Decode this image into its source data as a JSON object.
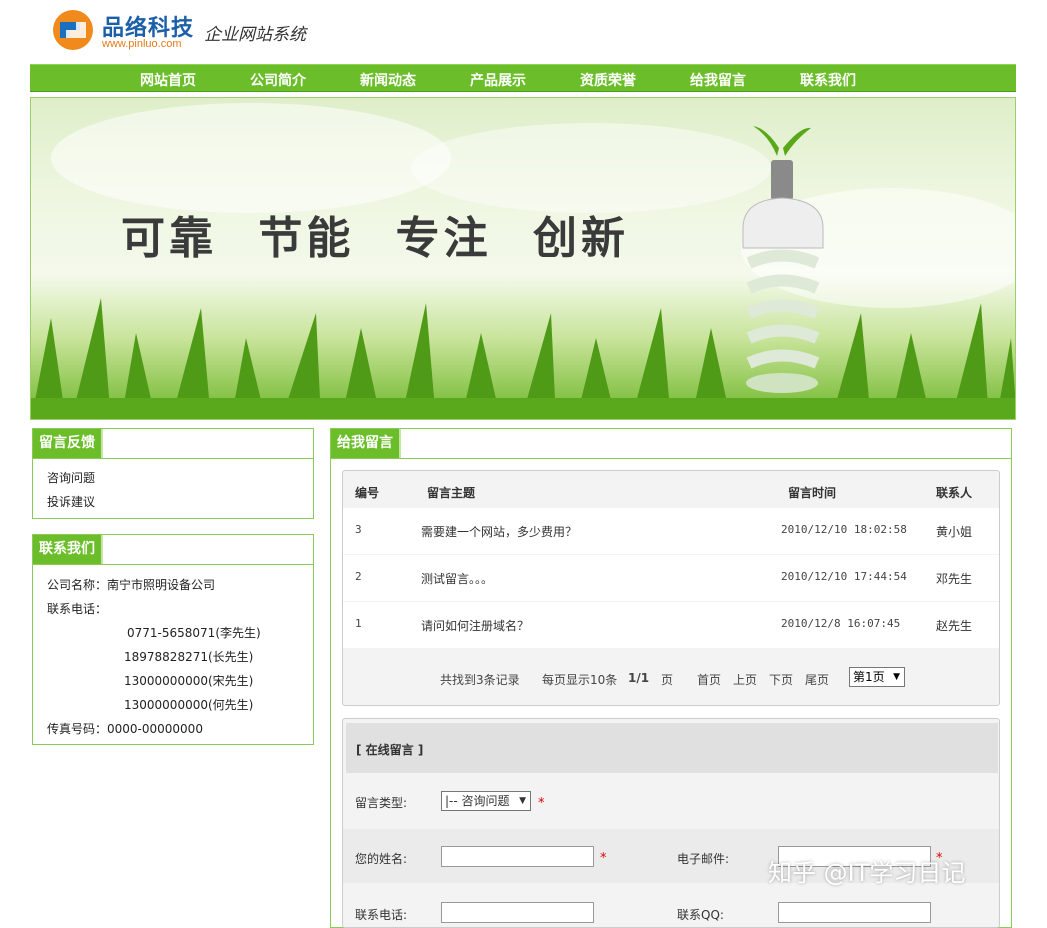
{
  "brand": {
    "name": "品络科技",
    "url": "www.pinluo.com",
    "subtitle": "企业网站系统"
  },
  "nav": [
    "网站首页",
    "公司简介",
    "新闻动态",
    "产品展示",
    "资质荣誉",
    "给我留言",
    "联系我们"
  ],
  "banner": {
    "slogan": "可靠 节能 专注 创新"
  },
  "sidebar": {
    "feedback": {
      "title": "留言反馈",
      "items": [
        "咨询问题",
        "投诉建议"
      ]
    },
    "contact": {
      "title": "联系我们",
      "company": "公司名称：南宁市照明设备公司",
      "phone_label": "联系电话：",
      "phones": [
        "0771-5658071(李先生)",
        "18978828271(长先生)",
        "13000000000(宋先生)",
        "13000000000(何先生)"
      ],
      "fax": "传真号码：0000-00000000"
    }
  },
  "main": {
    "title": "给我留言",
    "table": {
      "headers": [
        "编号",
        "留言主题",
        "留言时间",
        "联系人"
      ],
      "rows": [
        {
          "id": "3",
          "subject": "需要建一个网站，多少费用？",
          "time": "2010/12/10 18:02:58",
          "contact": "黄小姐"
        },
        {
          "id": "2",
          "subject": "测试留言。。。",
          "time": "2010/12/10 17:44:54",
          "contact": "邓先生"
        },
        {
          "id": "1",
          "subject": "请问如何注册域名？",
          "time": "2010/12/8 16:07:45",
          "contact": "赵先生"
        }
      ],
      "pagination": {
        "found": "共找到3条记录",
        "per_page": "每页显示10条",
        "page_of": "1/1",
        "page_unit": "页",
        "first": "首页",
        "prev": "上页",
        "next": "下页",
        "last": "尾页",
        "select": "第1页"
      }
    },
    "form": {
      "title": "[ 在线留言 ]",
      "type_label": "留言类型:",
      "type_value": "|-- 咨询问题",
      "name_label": "您的姓名:",
      "email_label": "电子邮件:",
      "phone_label": "联系电话:",
      "qq_label": "联系QQ:",
      "required_mark": "*"
    }
  },
  "watermark": "知乎 @IT学习日记"
}
